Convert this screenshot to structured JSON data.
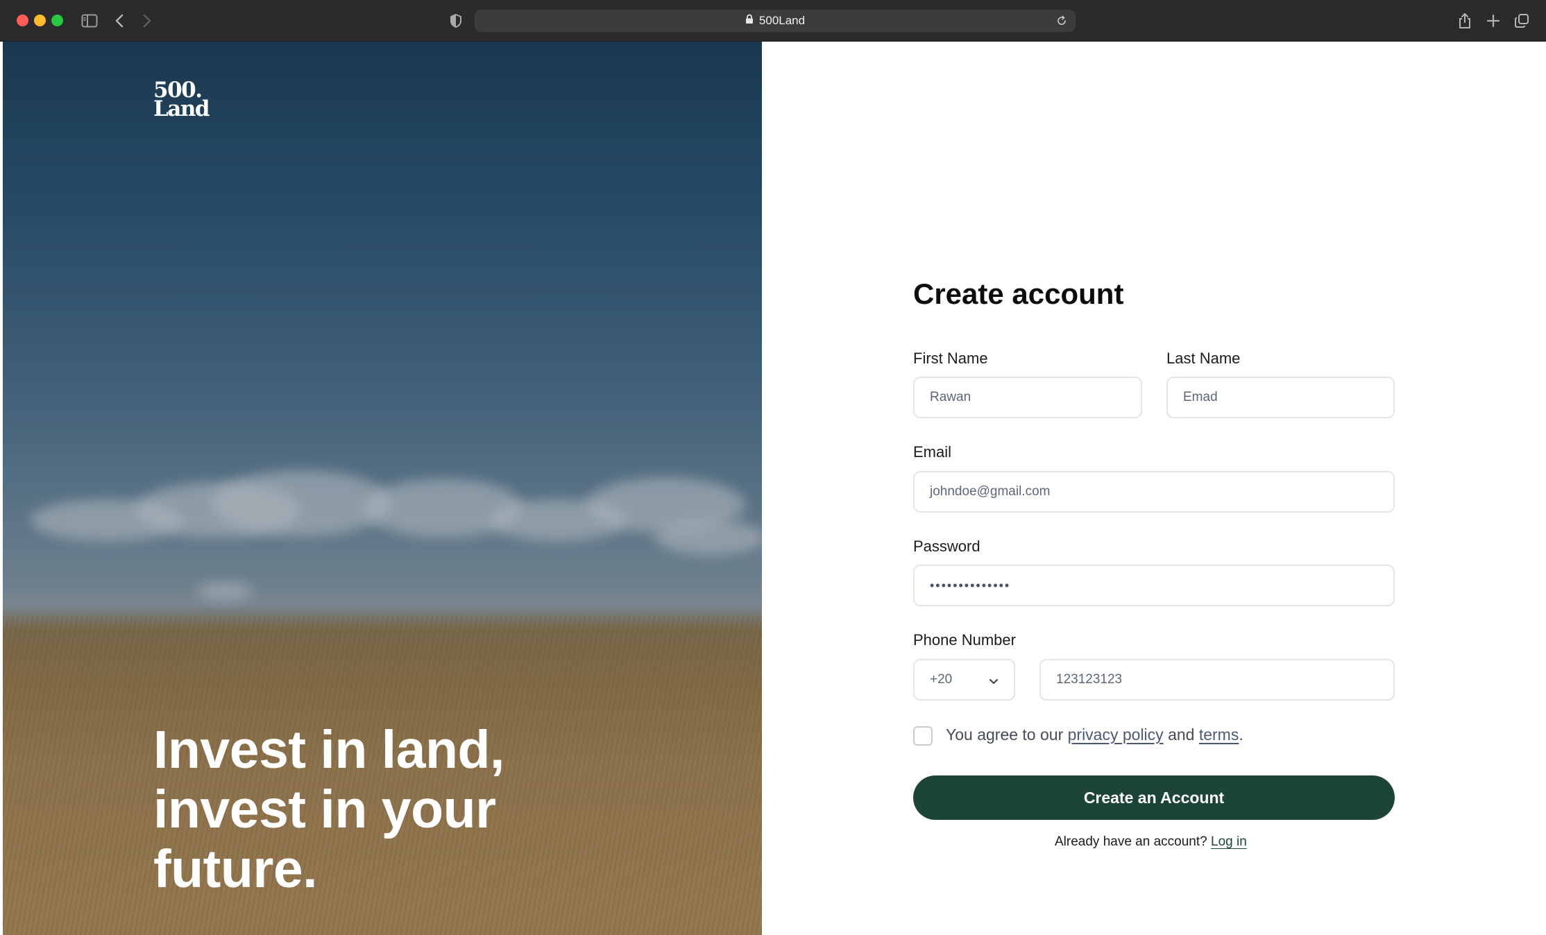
{
  "browser": {
    "url": "500Land",
    "icons": {
      "sidebar": "sidebar-icon",
      "back": "chevron-left-icon",
      "forward": "chevron-right-icon",
      "shield": "shield-icon",
      "lock": "lock-icon",
      "reload": "reload-icon",
      "share": "share-icon",
      "new_tab": "plus-icon",
      "tab_overview": "tabs-icon"
    }
  },
  "hero": {
    "logo_line1": "500.",
    "logo_line2": "Land",
    "headline_line1": "Invest in land,",
    "headline_line2": "invest in your",
    "headline_line3": "future."
  },
  "form": {
    "title": "Create account",
    "first_name": {
      "label": "First Name",
      "value": "Rawan"
    },
    "last_name": {
      "label": "Last Name",
      "value": "Emad"
    },
    "email": {
      "label": "Email",
      "value": "johndoe@gmail.com"
    },
    "password": {
      "label": "Password",
      "value": "••••••••••••••"
    },
    "phone": {
      "label": "Phone Number",
      "country_code": "+20",
      "number": "123123123"
    },
    "agree": {
      "prefix": "You agree to our",
      "privacy_link": "privacy policy",
      "and": "and",
      "terms_link": "terms",
      "suffix": "."
    },
    "submit_label": "Create an Account",
    "login_prompt": "Already have an account?",
    "login_link": "Log in"
  },
  "colors": {
    "primary": "#1c4536",
    "chrome": "#2b2b2d",
    "input_border": "#e3e5e8"
  }
}
